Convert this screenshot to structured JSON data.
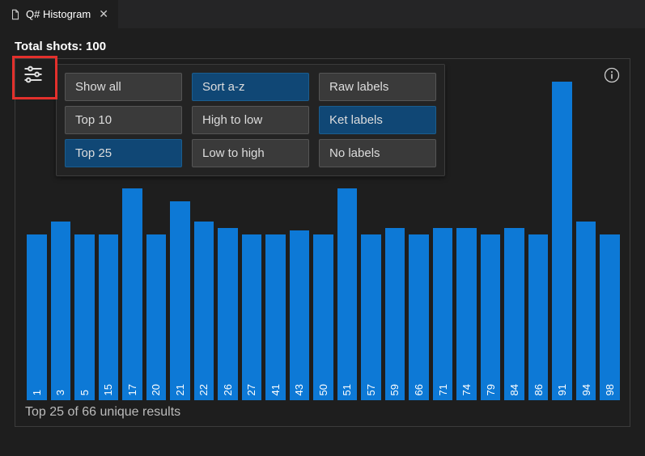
{
  "tab": {
    "title": "Q# Histogram"
  },
  "total_shots_label": "Total shots: 100",
  "options": {
    "col1": [
      {
        "label": "Show all",
        "selected": false
      },
      {
        "label": "Top 10",
        "selected": false
      },
      {
        "label": "Top 25",
        "selected": true
      }
    ],
    "col2": [
      {
        "label": "Sort a-z",
        "selected": true
      },
      {
        "label": "High to low",
        "selected": false
      },
      {
        "label": "Low to high",
        "selected": false
      }
    ],
    "col3": [
      {
        "label": "Raw labels",
        "selected": false
      },
      {
        "label": "Ket labels",
        "selected": true
      },
      {
        "label": "No labels",
        "selected": false
      }
    ]
  },
  "footer": "Top 25 of 66 unique results",
  "chart_data": {
    "type": "bar",
    "title": "",
    "xlabel": "",
    "ylabel": "",
    "ylim": [
      0,
      250
    ],
    "categories": [
      "1",
      "3",
      "5",
      "15",
      "17",
      "20",
      "21",
      "22",
      "26",
      "27",
      "41",
      "43",
      "50",
      "51",
      "57",
      "59",
      "66",
      "71",
      "74",
      "79",
      "84",
      "86",
      "91",
      "94",
      "98"
    ],
    "values": [
      125,
      135,
      125,
      125,
      160,
      125,
      150,
      135,
      130,
      125,
      125,
      128,
      125,
      160,
      125,
      130,
      125,
      130,
      130,
      125,
      130,
      125,
      240,
      135,
      125
    ]
  }
}
